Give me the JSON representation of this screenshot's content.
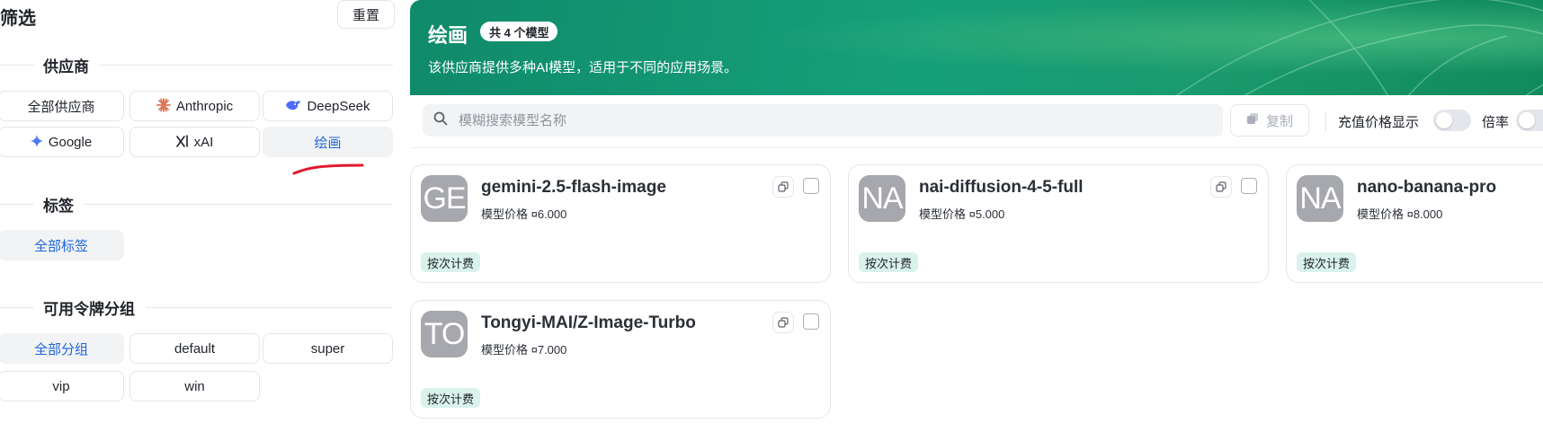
{
  "sidebar": {
    "title": "筛选",
    "reset_label": "重置",
    "provider_section": "供应商",
    "providers": [
      {
        "label": "全部供应商",
        "icon": "none"
      },
      {
        "label": "Anthropic",
        "icon": "anthropic-icon"
      },
      {
        "label": "DeepSeek",
        "icon": "deepseek-icon"
      },
      {
        "label": "Google",
        "icon": "google-gemini-icon"
      },
      {
        "label": "xAI",
        "icon": "xai-icon"
      },
      {
        "label": "绘画",
        "icon": "none",
        "active": true
      }
    ],
    "tag_section": "标签",
    "tags": [
      {
        "label": "全部标签",
        "active": true
      }
    ],
    "group_section": "可用令牌分组",
    "groups": [
      {
        "label": "全部分组",
        "active": true
      },
      {
        "label": "default"
      },
      {
        "label": "super"
      },
      {
        "label": "vip"
      },
      {
        "label": "win"
      }
    ]
  },
  "banner": {
    "title": "绘画",
    "badge": "共 4 个模型",
    "description": "该供应商提供多种AI模型，适用于不同的应用场景。"
  },
  "toolbar": {
    "search_placeholder": "模糊搜索模型名称",
    "copy_label": "复制",
    "recharge_price_label": "充值价格显示",
    "ratio_label": "倍率"
  },
  "models": [
    {
      "initials": "GE",
      "name": "gemini-2.5-flash-image",
      "price": "模型价格 ¤6.000",
      "billing": "按次计费"
    },
    {
      "initials": "NA",
      "name": "nai-diffusion-4-5-full",
      "price": "模型价格 ¤5.000",
      "billing": "按次计费"
    },
    {
      "initials": "NA",
      "name": "nano-banana-pro",
      "price": "模型价格 ¤8.000",
      "billing": "按次计费"
    },
    {
      "initials": "TO",
      "name": "Tongyi-MAI/Z-Image-Turbo",
      "price": "模型价格 ¤7.000",
      "billing": "按次计费"
    }
  ],
  "colors": {
    "accent": "#1d66d6",
    "banner_green": "#16a07a",
    "annotation_red": "#e0192b",
    "avatar_gray": "#a6a8ad",
    "tag_bg": "#d9f2ec"
  }
}
